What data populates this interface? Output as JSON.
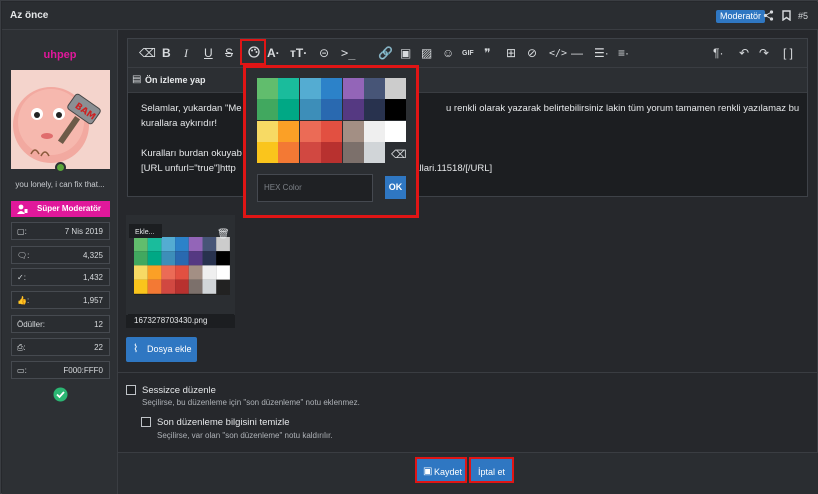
{
  "header": {
    "title": "Az önce",
    "badge": "Moderatör",
    "post_number": "#5",
    "icons": [
      "share-icon",
      "bookmark-icon"
    ]
  },
  "user": {
    "username": "uhpep",
    "custom_title": "you lonely, i can fix that...",
    "role": "Süper Moderatör",
    "stats": [
      {
        "icon": "calendar-icon",
        "label": ":",
        "value": "7 Nis 2019"
      },
      {
        "icon": "messages-icon",
        "label": ":",
        "value": "4,325"
      },
      {
        "icon": "check-icon",
        "label": ":",
        "value": "1,432"
      },
      {
        "icon": "thumbs-up-icon",
        "label": ":",
        "value": "1,957"
      },
      {
        "icon": "",
        "label": "Ödüller:",
        "value": "12"
      },
      {
        "icon": "printer-icon",
        "label": ":",
        "value": "22"
      },
      {
        "icon": "map-icon",
        "label": ":",
        "value": "F000:FFF0"
      }
    ]
  },
  "editor": {
    "preview_label": "Ön izleme yap",
    "content_line1": "Selamlar, yukardan \"Me",
    "content_line1_end": "u renkli olarak yazarak belirtebilirsiniz lakin tüm yorum tamamen renkli yazılamaz bu",
    "content_line2": "kurallara aykırıdır!",
    "content_line3": "Kuralları burdan okuyab",
    "content_line4": "[URL unfurl=\"true\"]http",
    "content_line4_end": "kurallari.11518/[/URL]"
  },
  "color_picker": {
    "colors": [
      [
        "#61bd6d",
        "#1abc9c",
        "#54acd2",
        "#2c82c9",
        "#9365b8",
        "#475577",
        "#cccccc"
      ],
      [
        "#41a85f",
        "#00a885",
        "#3d8eb9",
        "#2969b0",
        "#553982",
        "#28324e",
        "#000000"
      ],
      [
        "#f7da64",
        "#fba026",
        "#eb6b56",
        "#e25041",
        "#a38f84",
        "#efefef",
        "#ffffff"
      ],
      [
        "#fac51c",
        "#f37934",
        "#d14841",
        "#b8312f",
        "#7c706b",
        "#d1d5d8",
        ""
      ]
    ],
    "hex_placeholder": "HEX Color",
    "ok_label": "OK"
  },
  "attachment": {
    "filename": "1673278703430.png",
    "insert_label": "Ekle...",
    "add_file_label": "Dosya ekle"
  },
  "options": {
    "silent_label": "Sessizce düzenle",
    "silent_hint": "Seçilirse, bu düzenleme için \"son düzenleme\" notu eklenmez.",
    "clear_label": "Son düzenleme bilgisini temizle",
    "clear_hint": "Seçilirse, var olan \"son düzenleme\" notu kaldırılır."
  },
  "actions": {
    "save_label": "Kaydet",
    "cancel_label": "İptal et"
  }
}
